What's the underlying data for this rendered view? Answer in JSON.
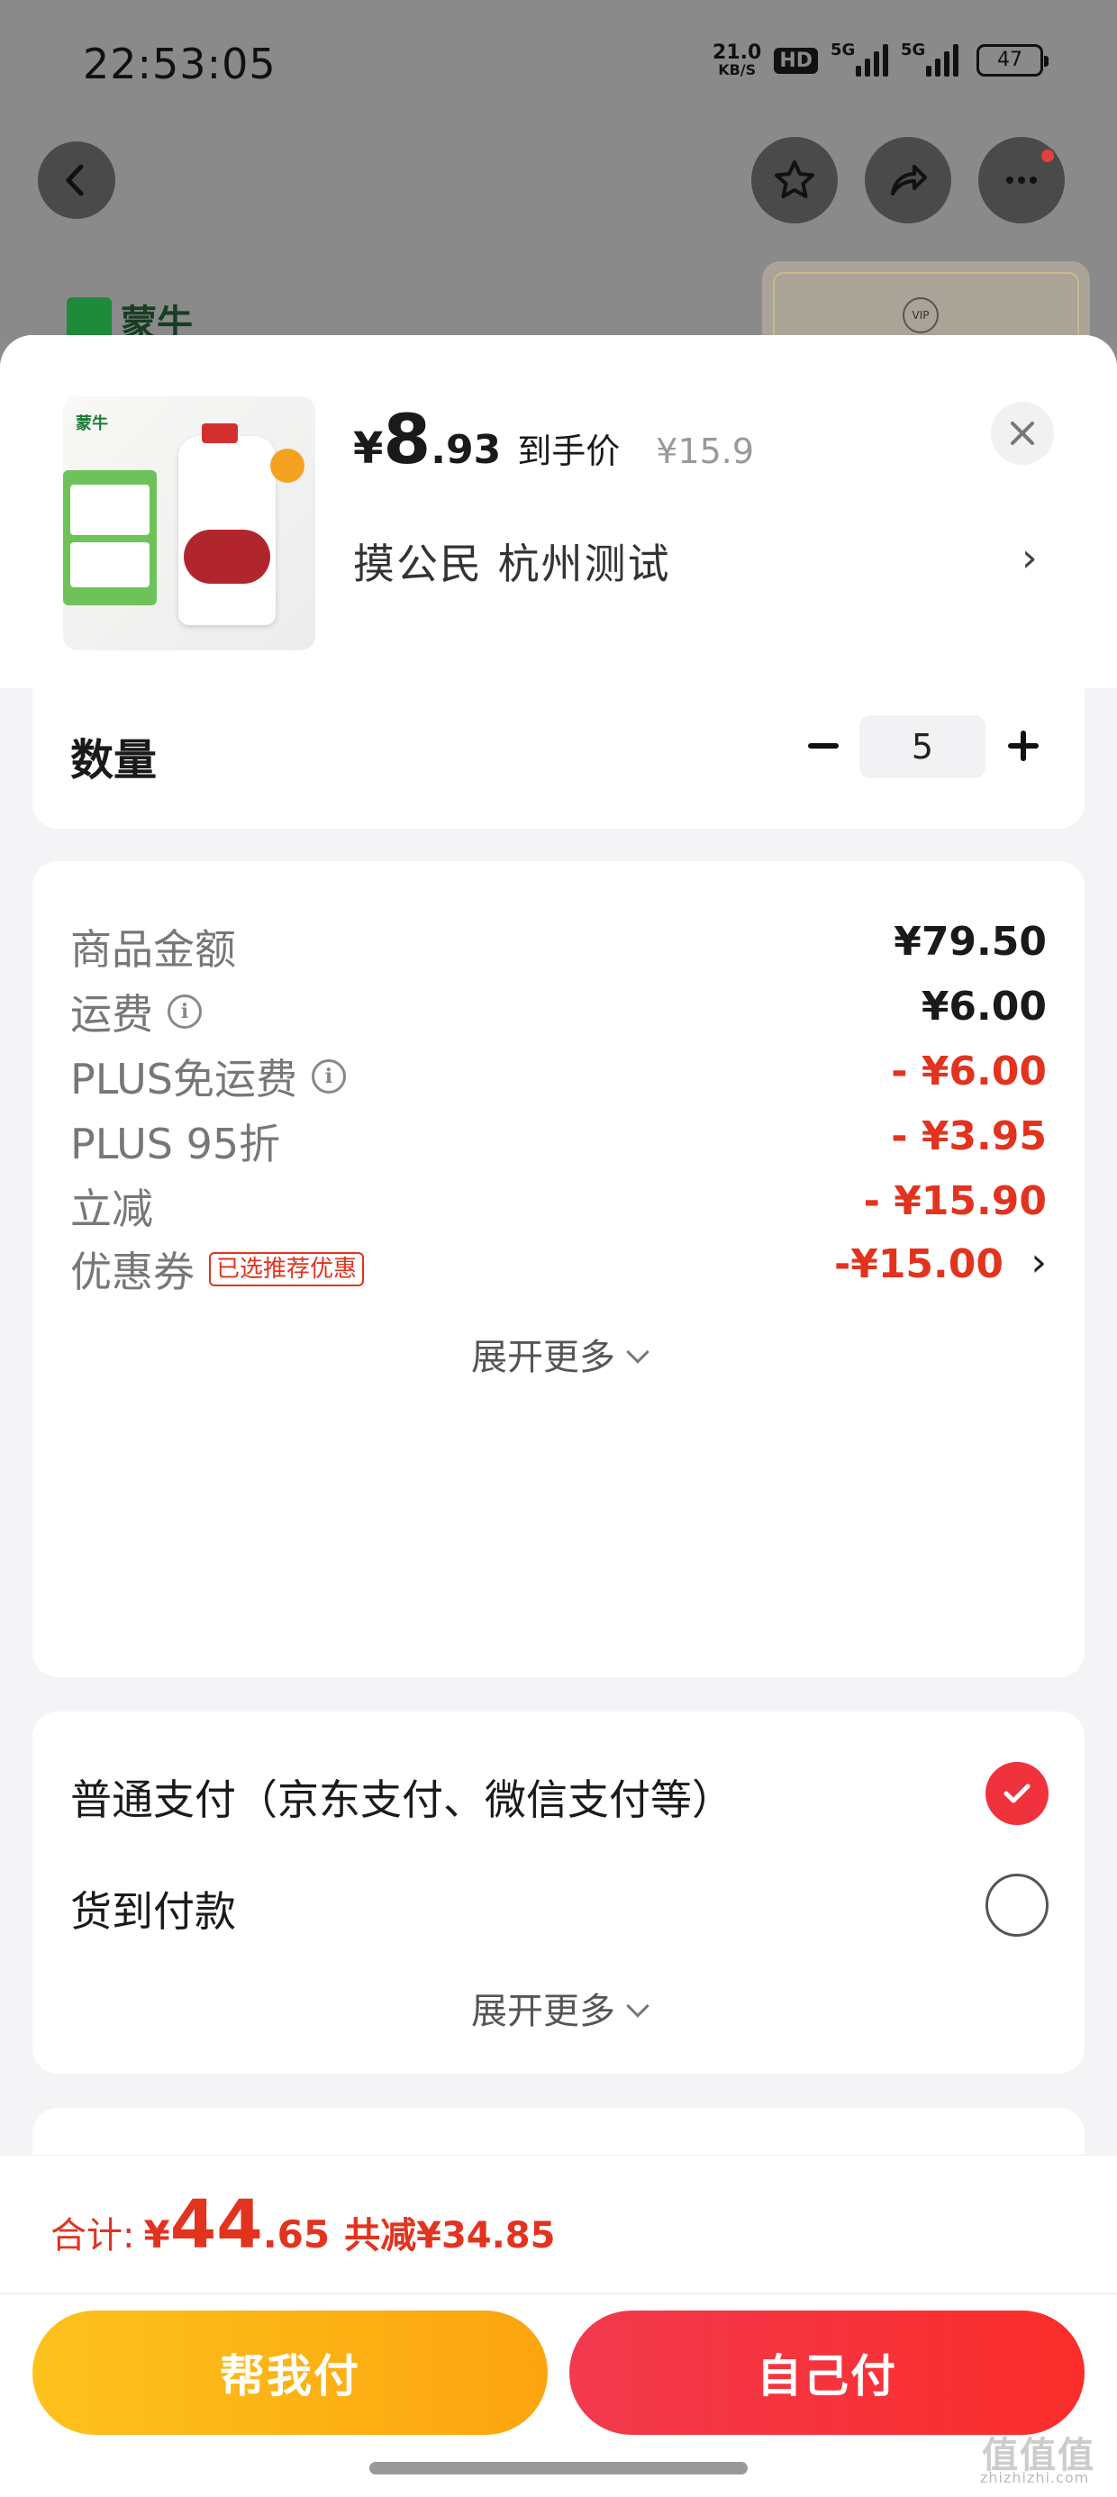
{
  "status_bar": {
    "time": "22:53:05",
    "net_speed": "21.0",
    "net_unit": "KB/S",
    "hd": "HD",
    "signal1": "5G",
    "signal2": "5G",
    "battery": "47"
  },
  "nav": {
    "back_icon": "chevron-left-icon",
    "favorite_icon": "star-icon",
    "share_icon": "share-icon",
    "more_icon": "more-dots-icon"
  },
  "background_page": {
    "brand": "蒙牛"
  },
  "sheet": {
    "product_image_brand": "蒙牛",
    "price_symbol": "¥",
    "price_int": "8",
    "price_dec": ".93",
    "price_tag": "到手价",
    "original_price": "¥15.9",
    "address": "摸公民  杭州测试",
    "address_chevron": "›",
    "close_icon": "close-icon"
  },
  "quantity": {
    "label": "数量",
    "value": "5"
  },
  "fees": {
    "items": [
      {
        "label": "商品金额",
        "value": "¥79.50",
        "info": false,
        "red": false
      },
      {
        "label": "运费",
        "value": "¥6.00",
        "info": true,
        "red": false
      },
      {
        "label": "PLUS免运费",
        "value": "- ¥6.00",
        "info": true,
        "red": true
      },
      {
        "label": "PLUS 95折",
        "value": "- ¥3.95",
        "info": false,
        "red": true
      },
      {
        "label": "立减",
        "value": "- ¥15.90",
        "info": false,
        "red": true
      }
    ],
    "coupon_label": "优惠券",
    "coupon_tag": "已选推荐优惠",
    "coupon_value": "-¥15.00",
    "coupon_chevron": "›",
    "expand_more": "展开更多"
  },
  "payment": {
    "options": [
      {
        "label": "普通支付（京东支付、微信支付等）",
        "selected": true
      },
      {
        "label": "货到付款",
        "selected": false
      }
    ],
    "expand_more": "展开更多"
  },
  "bottom_bar": {
    "total_label": "合计:",
    "total_symbol": "¥",
    "total_int": "44",
    "total_dec": ".65",
    "total_saved": "共减¥34.85",
    "help_pay": "帮我付",
    "self_pay": "自己付"
  },
  "watermark": {
    "text": "值值值",
    "site": "zhizhizhi.com"
  },
  "colors": {
    "accent_red": "#e2331f",
    "help_pay_yellow": "#fdb514",
    "self_pay_red": "#f3303f"
  }
}
